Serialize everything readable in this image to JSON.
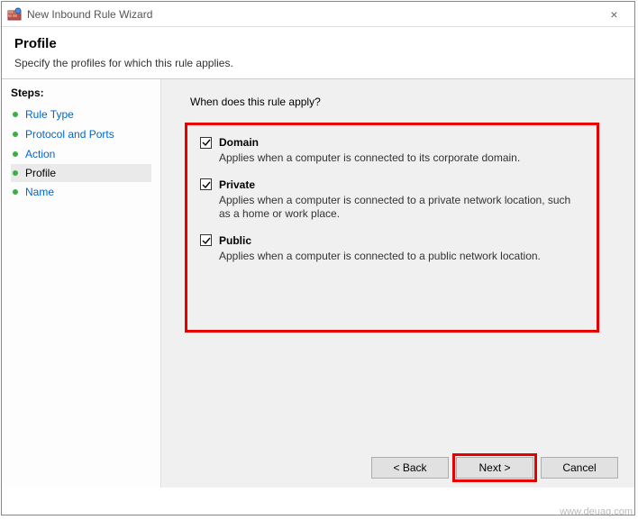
{
  "window": {
    "title": "New Inbound Rule Wizard",
    "close_glyph": "×"
  },
  "header": {
    "title": "Profile",
    "subtitle": "Specify the profiles for which this rule applies."
  },
  "sidebar": {
    "title": "Steps:",
    "items": [
      {
        "label": "Rule Type",
        "current": false
      },
      {
        "label": "Protocol and Ports",
        "current": false
      },
      {
        "label": "Action",
        "current": false
      },
      {
        "label": "Profile",
        "current": true
      },
      {
        "label": "Name",
        "current": false
      }
    ]
  },
  "main": {
    "question": "When does this rule apply?",
    "options": [
      {
        "label": "Domain",
        "checked": true,
        "desc": "Applies when a computer is connected to its corporate domain."
      },
      {
        "label": "Private",
        "checked": true,
        "desc": "Applies when a computer is connected to a private network location, such as a home or work place."
      },
      {
        "label": "Public",
        "checked": true,
        "desc": "Applies when a computer is connected to a public network location."
      }
    ]
  },
  "buttons": {
    "back": "< Back",
    "next": "Next >",
    "cancel": "Cancel"
  },
  "watermark": "www.deuaq.com"
}
